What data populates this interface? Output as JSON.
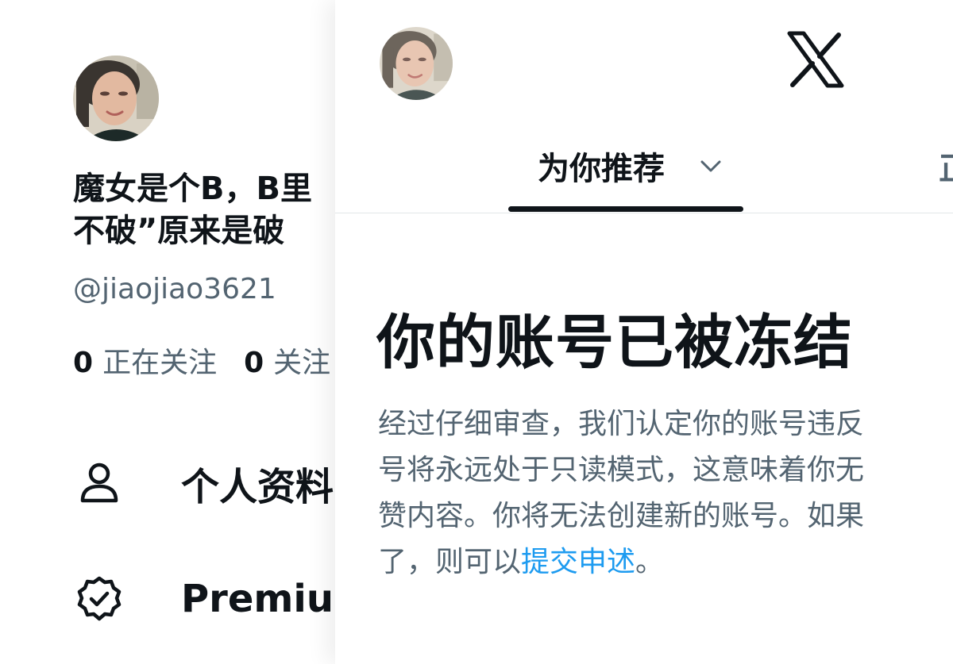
{
  "drawer": {
    "avatar_alt": "profile photo",
    "display_name_line1": "魔女是个B，B里",
    "display_name_line2": "不破”原来是破",
    "handle": "@jiaojiao3621",
    "following_count": "0",
    "following_label": "正在关注",
    "followers_count": "0",
    "followers_label": "关注",
    "menu": [
      {
        "label": "个人资料",
        "icon": "person-icon"
      },
      {
        "label": "Premium",
        "icon": "verified-badge-icon"
      }
    ]
  },
  "header": {
    "logo": "x-logo-icon",
    "tabs": [
      {
        "label": "为你推荐",
        "selected": true
      },
      {
        "label": "正在关注",
        "selected": false
      }
    ]
  },
  "notice": {
    "title": "你的账号已被冻结",
    "body_line1": "经过仔细审查，我们认定你的账号违反",
    "body_line2": "号将永远处于只读模式，这意味着你无",
    "body_line3": "赞内容。你将无法创建新的账号。如果",
    "body_line4_prefix": "了，则可以",
    "body_link": "提交申述",
    "body_line4_suffix": "。"
  },
  "colors": {
    "text_primary": "#0f1419",
    "text_secondary": "#536471",
    "link": "#1d9bf0",
    "divider": "#e3e6e8"
  }
}
